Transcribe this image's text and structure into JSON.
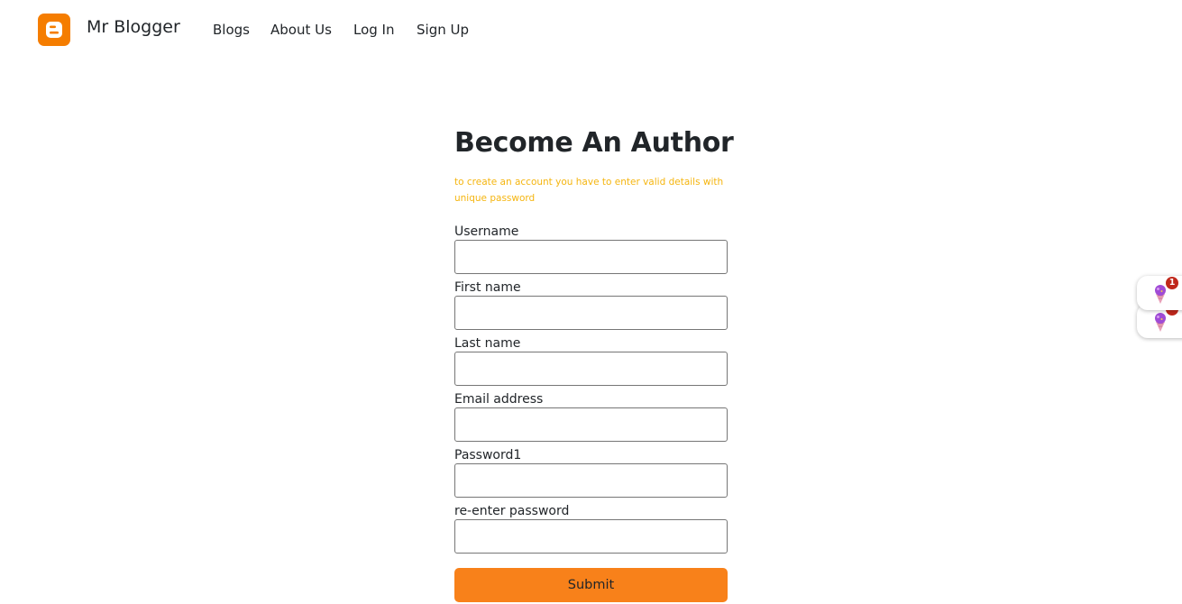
{
  "brand": {
    "name": "Mr Blogger",
    "logo_icon": "blogger-logo-icon",
    "logo_color": "#f57d00"
  },
  "nav": {
    "links": [
      {
        "label": "Blogs"
      },
      {
        "label": "About Us"
      },
      {
        "label": "Log In"
      },
      {
        "label": "Sign Up"
      }
    ]
  },
  "form": {
    "title": "Become An Author",
    "subtitle": "to create an account you have to enter valid details with unique password",
    "subtitle_color": "#f5b50f",
    "fields": [
      {
        "label": "Username",
        "value": ""
      },
      {
        "label": "First name",
        "value": ""
      },
      {
        "label": "Last name",
        "value": ""
      },
      {
        "label": "Email address",
        "value": ""
      },
      {
        "label": "Password1",
        "value": ""
      },
      {
        "label": "re-enter password",
        "value": ""
      }
    ],
    "submit_label": "Submit",
    "submit_color": "#f8811a"
  },
  "floating_widgets": [
    {
      "icon": "ice-cream-icon",
      "badge": "1"
    },
    {
      "icon": "ice-cream-icon",
      "badge": ""
    }
  ]
}
